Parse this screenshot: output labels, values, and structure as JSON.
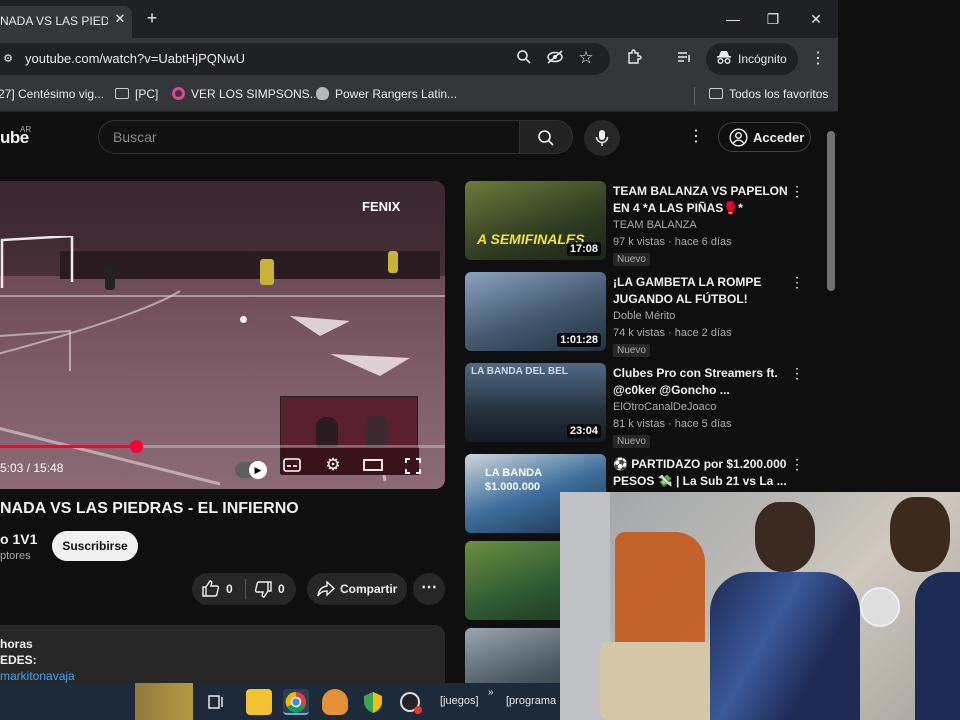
{
  "browser": {
    "tab_title": "NADA VS LAS PIEDR",
    "url": "youtube.com/watch?v=UabtHjPQNwU",
    "incognito_label": "Incógnito",
    "bookmarks": [
      {
        "label": "27] Centésimo vig...",
        "icon": "favicon-icon"
      },
      {
        "label": "[PC]",
        "icon": "folder-icon"
      },
      {
        "label": "VER LOS SIMPSONS...",
        "icon": "donut-icon"
      },
      {
        "label": "Power Rangers Latin...",
        "icon": "alien-icon"
      }
    ],
    "all_bookmarks_label": "Todos los favoritos"
  },
  "youtube": {
    "logo_text": "ube",
    "logo_region": "AR",
    "search_placeholder": "Buscar",
    "signin_label": "Acceder",
    "player": {
      "timecode": "5:03 / 15:48",
      "progress_fraction": 0.32,
      "overlay_brand": "FENIX"
    },
    "video_title": "NADA VS LAS PIEDRAS - EL INFIERNO",
    "channel_name": "o 1V1",
    "subscribers": "ptores",
    "subscribe_label": "Suscribirse",
    "likes": "0",
    "dislikes": "0",
    "share_label": "Compartir",
    "description": {
      "line1": "horas",
      "line2": "EDES:",
      "line3": "markitonavaja"
    },
    "recommendations": [
      {
        "title": "TEAM BALANZA VS PAPELON EN 4 *A LAS PIÑAS🥊*",
        "channel": "TEAM BALANZA",
        "meta": "97 k vistas · hace 6 días",
        "badge": "Nuevo",
        "duration": "17:08",
        "thumb_text": "A SEMIFINALES",
        "thumb_color": "#3d5a2a"
      },
      {
        "title": "¡LA GAMBETA LA ROMPE JUGANDO AL FÚTBOL! PICHU,...",
        "channel": "Doble Mérito",
        "meta": "74 k vistas · hace 2 días",
        "badge": "Nuevo",
        "duration": "1:01:28",
        "thumb_text": "",
        "thumb_color": "#5c6f86"
      },
      {
        "title": "Clubes Pro con Streamers ft. @c0ker @Goncho ...",
        "channel": "ElOtroCanalDeJoaco",
        "meta": "81 k vistas · hace 5 días",
        "badge": "Nuevo",
        "duration": "23:04",
        "thumb_text": "LA BANDA DEL BEL",
        "thumb_color": "#3a4a5c"
      },
      {
        "title": "⚽ PARTIDAZO por $1.200.000 PESOS 💸 | La Sub 21 vs La ...",
        "channel": "",
        "meta": "",
        "badge": "",
        "duration": "",
        "thumb_text": "LA BANDA $1.000.000",
        "thumb_color": "#2d4a6e"
      },
      {
        "title": "",
        "channel": "",
        "meta": "",
        "badge": "",
        "duration": "",
        "thumb_text": "",
        "thumb_color": "#2e5b33"
      },
      {
        "title": "",
        "channel": "",
        "meta": "",
        "badge": "",
        "duration": "",
        "thumb_text": "",
        "thumb_color": "#4a5660"
      }
    ]
  },
  "taskbar": {
    "items": [
      {
        "label": "",
        "icon": "owl-icon"
      },
      {
        "label": "",
        "icon": "task-view-icon"
      },
      {
        "label": "",
        "icon": "file-explorer-icon"
      },
      {
        "label": "",
        "icon": "chrome-icon"
      },
      {
        "label": "",
        "icon": "fl-studio-icon"
      },
      {
        "label": "",
        "icon": "shield-app-icon"
      },
      {
        "label": "",
        "icon": "obs-icon"
      }
    ],
    "folder_label": "[juegos]",
    "folder2_label": "[programa"
  }
}
